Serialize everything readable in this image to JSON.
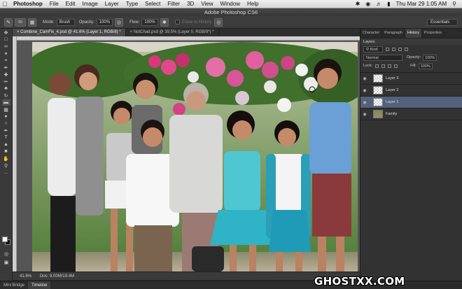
{
  "menubar": {
    "app": "Photoshop",
    "items": [
      "File",
      "Edit",
      "Image",
      "Layer",
      "Type",
      "Select",
      "Filter",
      "3D",
      "View",
      "Window",
      "Help"
    ],
    "clock": "Thu Mar 29  1:05 AM"
  },
  "window_title": "Adobe Photoshop CS6",
  "options": {
    "size_value": "50",
    "mode_label": "Mode:",
    "mode_value": "Brush",
    "opacity_label": "Opacity:",
    "opacity_value": "100%",
    "flow_label": "Flow:",
    "flow_value": "100%",
    "erase_history": "Erase to History",
    "workspace": "Essentials"
  },
  "doc_tabs": [
    {
      "label": "Combine_CamFix_4.psd @ 41.6% (Layer 1, RGB/8) *",
      "active": true
    },
    {
      "label": "NotChad.psd @ 39.5% (Layer 0, RGB/8*) *",
      "active": false
    }
  ],
  "status": {
    "zoom": "41.6%",
    "doc": "Doc: 9.00M/19.4M"
  },
  "bottom_tabs": [
    {
      "label": "Mini Bridge",
      "active": false
    },
    {
      "label": "Timeline",
      "active": true
    }
  ],
  "panel_tabs": [
    {
      "label": "Character",
      "active": false
    },
    {
      "label": "Paragraph",
      "active": false
    },
    {
      "label": "History",
      "active": true
    },
    {
      "label": "Properties",
      "active": false
    }
  ],
  "layers_panel": {
    "title": "Layers",
    "kind": "Kind",
    "blend": "Normal",
    "opacity_label": "Opacity:",
    "opacity_value": "100%",
    "lock_label": "Lock:",
    "fill_label": "Fill:",
    "fill_value": "100%",
    "layers": [
      {
        "name": "Layer 3",
        "selected": false
      },
      {
        "name": "Layer 2",
        "selected": false
      },
      {
        "name": "Layer 1",
        "selected": true
      },
      {
        "name": "Family",
        "selected": false
      }
    ]
  },
  "watermark": "GHOSTXX.COM"
}
